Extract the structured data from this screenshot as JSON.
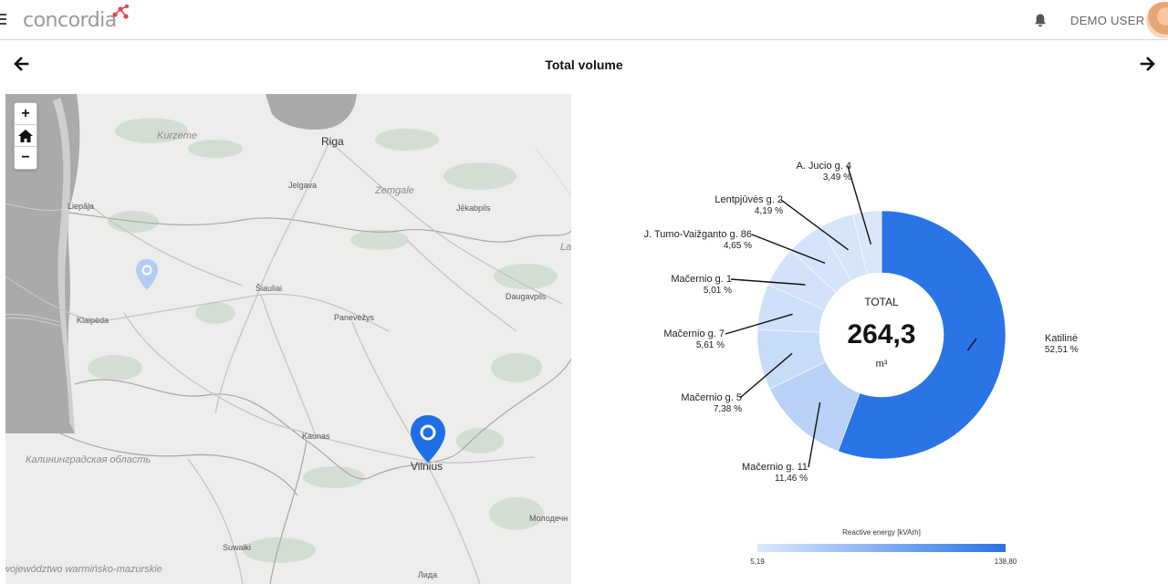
{
  "header": {
    "logo_text": "concordia",
    "user_name": "DEMO USER"
  },
  "page": {
    "title": "Total volume"
  },
  "map": {
    "labels": {
      "riga": "Riga",
      "kurzeme": "Kurzeme",
      "zemgale": "Zemgale",
      "jelgava": "Jelgava",
      "jekabpils": "Jēkabpils",
      "liepaja": "Liepāja",
      "siauliai": "Šiauliai",
      "daugavpils": "Daugavpils",
      "panevezys": "Panevėžys",
      "klaipeda": "Klaipėda",
      "kaunas": "Kaunas",
      "vilnius": "Vilnius",
      "kaliningrad": "Калининградская область",
      "molodechno": "Молодечн",
      "suwalki": "Suwałki",
      "warminsko": "województwo warmińsko-mazurskie",
      "lida": "Лида",
      "la": "La"
    },
    "zoom_in": "+",
    "zoom_out": "−"
  },
  "chart_data": {
    "type": "pie",
    "variant": "donut",
    "center_label": "TOTAL",
    "center_value": "264,3",
    "center_unit": "m³",
    "slices": [
      {
        "name": "Katilinė",
        "percent_label": "52,51 %",
        "value": 52.51,
        "color": "#2a74e6"
      },
      {
        "name": "Mačernio g. 11",
        "percent_label": "11,46 %",
        "value": 11.46,
        "color": "#b9d1f7"
      },
      {
        "name": "Mačernio g. 5",
        "percent_label": "7,38 %",
        "value": 7.38,
        "color": "#c8dbf9"
      },
      {
        "name": "Mačernio g. 7",
        "percent_label": "5,61 %",
        "value": 5.61,
        "color": "#cfe0fa"
      },
      {
        "name": "Mačernio g. 1",
        "percent_label": "5,01 %",
        "value": 5.01,
        "color": "#d3e2fa"
      },
      {
        "name": "J. Tumo-Vaižganto g. 86",
        "percent_label": "4,65 %",
        "value": 4.65,
        "color": "#d5e4fb"
      },
      {
        "name": "Lentpjūvės g. 2",
        "percent_label": "4,19 %",
        "value": 4.19,
        "color": "#d7e5fb"
      },
      {
        "name": "A. Jucio g. 4",
        "percent_label": "3,49 %",
        "value": 3.49,
        "color": "#dae7fb"
      }
    ],
    "legend": {
      "title": "Reactive energy [kVArh]",
      "min_label": "5,19",
      "max_label": "138,80",
      "color_min": "#dce9fc",
      "color_max": "#2a74e6"
    }
  }
}
